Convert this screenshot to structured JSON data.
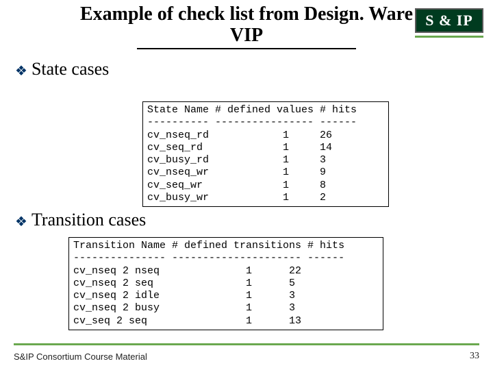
{
  "title_line1": "Example of check list from Design. Ware",
  "title_line2": "VIP",
  "logo_text": "S & IP",
  "bullets": {
    "state": "State cases",
    "transition": "Transition cases"
  },
  "state_block": "State Name # defined values # hits\n---------- ---------------- ------\ncv_nseq_rd            1     26\ncv_seq_rd             1     14\ncv_busy_rd            1     3\ncv_nseq_wr            1     9\ncv_seq_wr             1     8\ncv_busy_wr            1     2",
  "transition_block": "Transition Name # defined transitions # hits\n--------------- --------------------- ------\ncv_nseq 2 nseq              1      22\ncv_nseq 2 seq               1      5\ncv_nseq 2 idle              1      3\ncv_nseq 2 busy              1      3\ncv_seq 2 seq                1      13",
  "footer_left": "S&IP Consortium Course Material",
  "page_number": "33",
  "chart_data": [
    {
      "type": "table",
      "title": "State cases",
      "columns": [
        "State Name",
        "# defined values",
        "# hits"
      ],
      "rows": [
        [
          "cv_nseq_rd",
          1,
          26
        ],
        [
          "cv_seq_rd",
          1,
          14
        ],
        [
          "cv_busy_rd",
          1,
          3
        ],
        [
          "cv_nseq_wr",
          1,
          9
        ],
        [
          "cv_seq_wr",
          1,
          8
        ],
        [
          "cv_busy_wr",
          1,
          2
        ]
      ]
    },
    {
      "type": "table",
      "title": "Transition cases",
      "columns": [
        "Transition Name",
        "# defined transitions",
        "# hits"
      ],
      "rows": [
        [
          "cv_nseq 2 nseq",
          1,
          22
        ],
        [
          "cv_nseq 2 seq",
          1,
          5
        ],
        [
          "cv_nseq 2 idle",
          1,
          3
        ],
        [
          "cv_nseq 2 busy",
          1,
          3
        ],
        [
          "cv_seq 2 seq",
          1,
          13
        ]
      ]
    }
  ]
}
